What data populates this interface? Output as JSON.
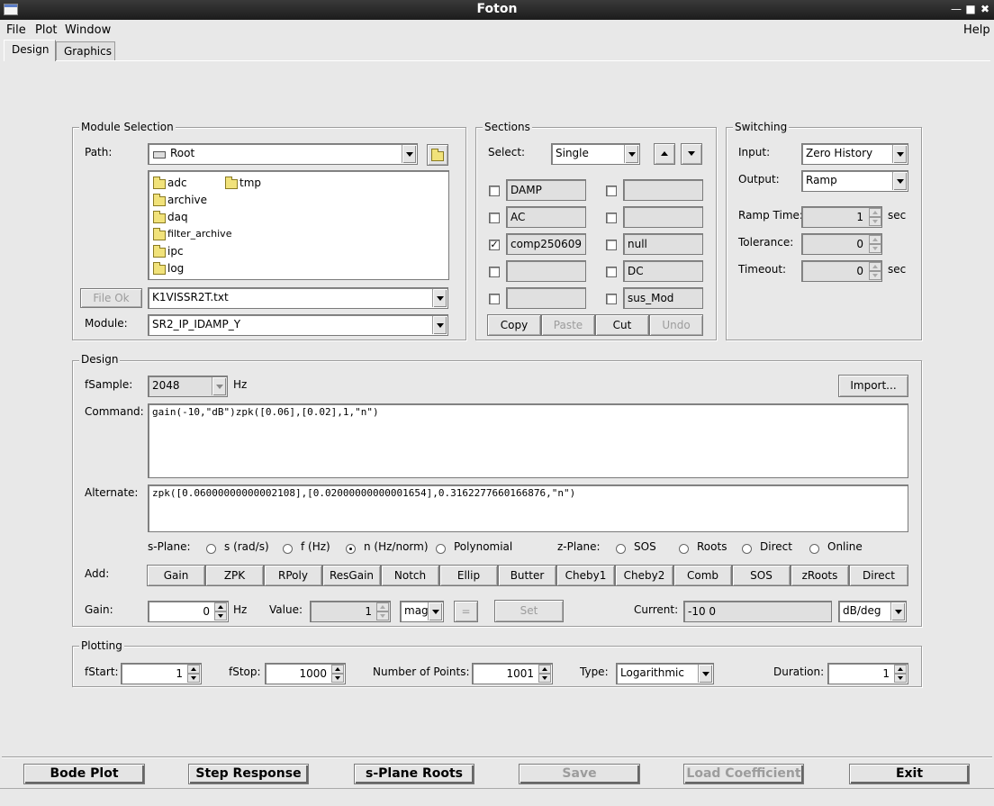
{
  "window": {
    "title": "Foton"
  },
  "menu": {
    "file": "File",
    "plot": "Plot",
    "window": "Window",
    "help": "Help"
  },
  "tabs": {
    "design": "Design",
    "graphics": "Graphics"
  },
  "module_selection": {
    "title": "Module Selection",
    "path_label": "Path:",
    "path_value": "Root",
    "folders": [
      "adc",
      "tmp",
      "archive",
      "daq",
      "filter_archive",
      "ipc",
      "log"
    ],
    "file_ok": "File Ok",
    "file_value": "K1VISSR2T.txt",
    "module_label": "Module:",
    "module_value": "SR2_IP_IDAMP_Y"
  },
  "sections": {
    "title": "Sections",
    "select_label": "Select:",
    "select_value": "Single",
    "left": [
      {
        "name": "DAMP",
        "checked": false
      },
      {
        "name": "AC",
        "checked": false
      },
      {
        "name": "comp250609",
        "checked": true
      },
      {
        "name": "",
        "checked": false
      },
      {
        "name": "",
        "checked": false
      }
    ],
    "right": [
      {
        "name": "",
        "checked": false
      },
      {
        "name": "",
        "checked": false
      },
      {
        "name": "null",
        "checked": false
      },
      {
        "name": "DC",
        "checked": false
      },
      {
        "name": "sus_Mod",
        "checked": false
      }
    ],
    "copy": "Copy",
    "paste": "Paste",
    "cut": "Cut",
    "undo": "Undo"
  },
  "switching": {
    "title": "Switching",
    "input_label": "Input:",
    "input_value": "Zero History",
    "output_label": "Output:",
    "output_value": "Ramp",
    "ramp_label": "Ramp Time:",
    "ramp_value": "1",
    "ramp_unit": "sec",
    "tolerance_label": "Tolerance:",
    "tolerance_value": "0",
    "timeout_label": "Timeout:",
    "timeout_value": "0",
    "timeout_unit": "sec"
  },
  "design": {
    "title": "Design",
    "fsample_label": "fSample:",
    "fsample_value": "2048",
    "fsample_unit": "Hz",
    "import": "Import...",
    "command_label": "Command:",
    "command_value": "gain(-10,\"dB\")zpk([0.06],[0.02],1,\"n\")",
    "alternate_label": "Alternate:",
    "alternate_value": "zpk([0.06000000000002108],[0.02000000000001654],0.3162277660166876,\"n\")",
    "splane_label": "s-Plane:",
    "splane_options": [
      "s (rad/s)",
      "f (Hz)",
      "n (Hz/norm)",
      "Polynomial"
    ],
    "zplane_label": "z-Plane:",
    "zplane_options": [
      "SOS",
      "Roots",
      "Direct",
      "Online"
    ],
    "add_label": "Add:",
    "add_buttons": [
      "Gain",
      "ZPK",
      "RPoly",
      "ResGain",
      "Notch",
      "Ellip",
      "Butter",
      "Cheby1",
      "Cheby2",
      "Comb",
      "SOS",
      "zRoots",
      "Direct"
    ],
    "gain_label": "Gain:",
    "gain_value": "0",
    "gain_unit": "Hz",
    "value_label": "Value:",
    "value_value": "1",
    "value_mode": "mag",
    "equals": "=",
    "set": "Set",
    "current_label": "Current:",
    "current_value": "-10  0",
    "current_unit": "dB/deg"
  },
  "plotting": {
    "title": "Plotting",
    "fstart_label": "fStart:",
    "fstart_value": "1",
    "fstop_label": "fStop:",
    "fstop_value": "1000",
    "npoints_label": "Number of Points:",
    "npoints_value": "1001",
    "type_label": "Type:",
    "type_value": "Logarithmic",
    "duration_label": "Duration:",
    "duration_value": "1"
  },
  "bottom": {
    "bode": "Bode Plot",
    "step": "Step Response",
    "splane": "s-Plane Roots",
    "save": "Save",
    "load": "Load Coefficient",
    "exit": "Exit"
  }
}
